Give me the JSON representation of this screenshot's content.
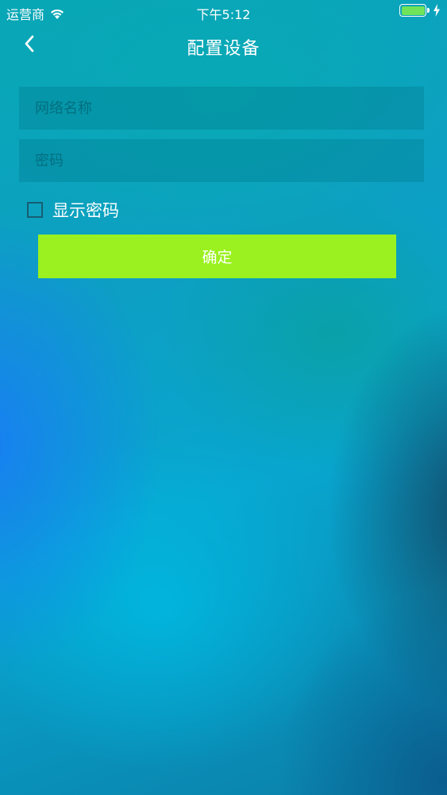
{
  "status_bar": {
    "carrier": "运营商",
    "time": "下午5:12",
    "battery_level": 1.0,
    "battery_color": "#6fe35a"
  },
  "nav": {
    "title": "配置设备",
    "back_icon": "chevron-left-icon"
  },
  "form": {
    "network_name": {
      "value": "",
      "placeholder": "网络名称"
    },
    "password": {
      "value": "",
      "placeholder": "密码"
    },
    "show_password": {
      "label": "显示密码",
      "checked": false
    },
    "confirm_label": "确定",
    "confirm_color": "#9af11f"
  }
}
